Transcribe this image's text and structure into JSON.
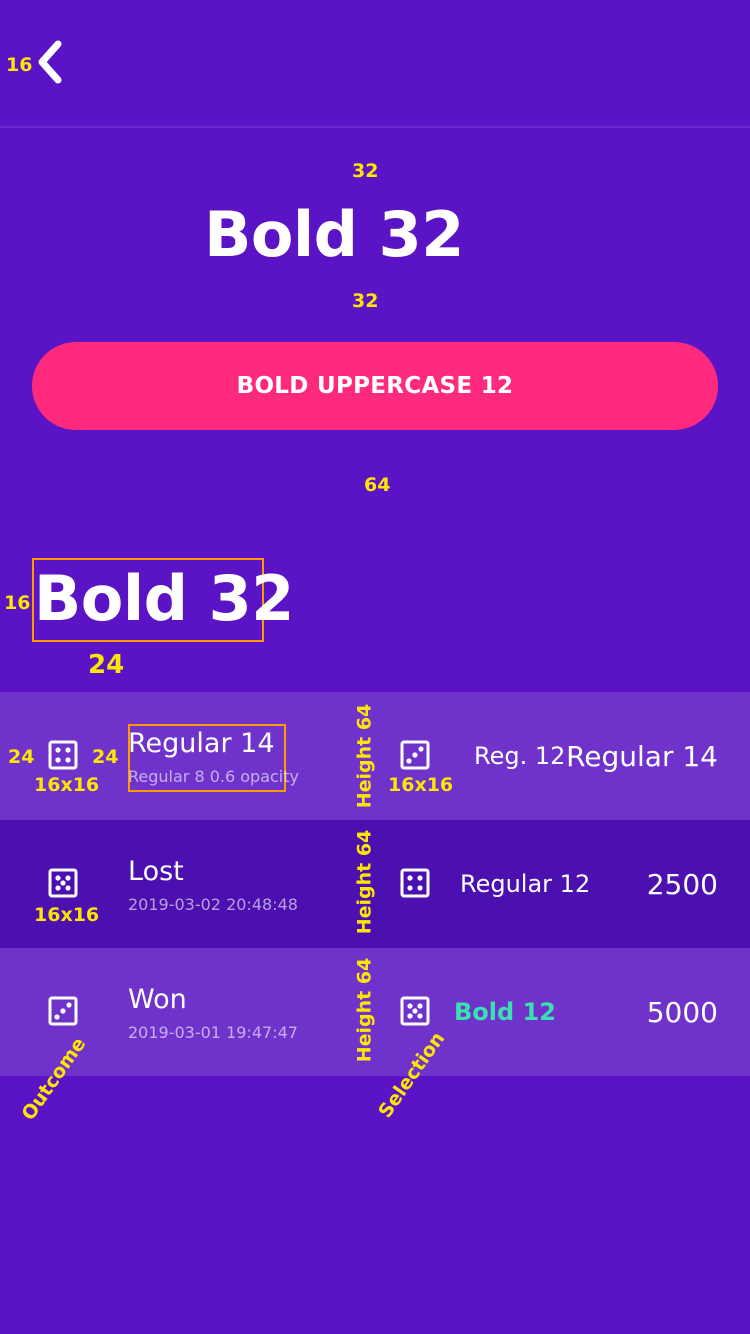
{
  "header": {
    "back_icon": "chevron-left-icon"
  },
  "hero": {
    "title": "Bold 32",
    "cta_label": "BOLD UPPERCASE 12"
  },
  "section": {
    "title": "Bold 32"
  },
  "rows": [
    {
      "primary": "Regular 14",
      "secondary": "Regular 8 0.6 opacity",
      "mid": "Reg. 12",
      "right": "Regular 14",
      "icon": "dice-four-icon",
      "mid_icon": "dice-three-icon"
    },
    {
      "primary": "Lost",
      "secondary": "2019-03-02 20:48:48",
      "mid": "Regular 12",
      "right": "2500",
      "icon": "dice-five-icon",
      "mid_icon": "dice-four-icon"
    },
    {
      "primary": "Won",
      "secondary": "2019-03-01 19:47:47",
      "mid": "Bold 12",
      "right": "5000",
      "icon": "dice-three-icon",
      "mid_icon": "dice-five-icon"
    }
  ],
  "annotations": {
    "back_pad": "16",
    "top_gap": "32",
    "bottom_gap": "32",
    "section_gap": "64",
    "title_pad": "16",
    "below_title": "24",
    "icon_left": "24",
    "icon_right": "24",
    "icon_size_1": "16x16",
    "icon_size_2": "16x16",
    "icon_size_3": "16x16",
    "height_1": "Height 64",
    "height_2": "Height 64",
    "height_3": "Height 64",
    "outcome": "Outcome",
    "selection": "Selection"
  },
  "colors": {
    "background": "#5a14c6",
    "row_light": "#6f33cc",
    "row_dark": "#4c0fb0",
    "cta": "#ff2a7d",
    "annotation": "#ffe600",
    "highlight_box": "#ff9900",
    "accent_green": "#3be0b0"
  }
}
